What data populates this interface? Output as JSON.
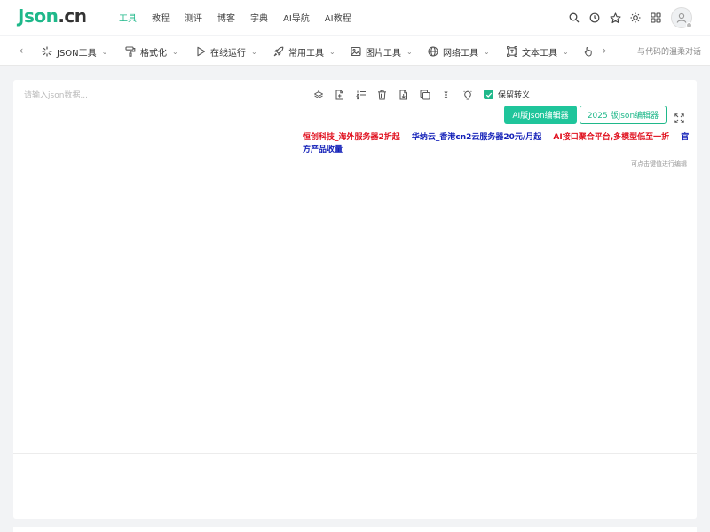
{
  "header": {
    "logo_part1": "Json",
    "logo_part2": ".cn",
    "nav": [
      "工具",
      "教程",
      "测评",
      "博客",
      "字典",
      "AI导航",
      "AI教程"
    ],
    "active_nav": 0,
    "icons": [
      "search-icon",
      "history-icon",
      "star-icon",
      "theme-sun-icon",
      "grid-icon",
      "avatar"
    ]
  },
  "toolbar": {
    "items": [
      {
        "label": "JSON工具",
        "icon": "spinner-icon"
      },
      {
        "label": "格式化",
        "icon": "paint-roller-icon"
      },
      {
        "label": "在线运行",
        "icon": "play-icon"
      },
      {
        "label": "常用工具",
        "icon": "rocket-icon"
      },
      {
        "label": "图片工具",
        "icon": "image-icon"
      },
      {
        "label": "网络工具",
        "icon": "globe-icon"
      },
      {
        "label": "文本工具",
        "icon": "text-frame-icon"
      }
    ],
    "slogan": "与代码的温柔对话"
  },
  "editor": {
    "placeholder": "请输入json数据...",
    "keep_escape_label": "保留转义",
    "keep_escape_checked": true,
    "ai_button": "AI版Json编辑器",
    "button_2025": "2025 版Json编辑器",
    "hint": "可点击键值进行编辑",
    "tools": [
      "layers-icon",
      "file-icon",
      "list-ordered-icon",
      "trash-icon",
      "file-download-icon",
      "copy-icon",
      "compress-icon",
      "lightbulb-icon"
    ]
  },
  "ads": [
    {
      "text": "恒创科技_海外服务器2折起",
      "color": "red"
    },
    {
      "text": "华纳云_香港cn2云服务器20元/月起",
      "color": "blue"
    },
    {
      "text": "AI接口聚合平台,多模型低至一折",
      "color": "red"
    },
    {
      "text": "官方产品收量",
      "color": "blue"
    }
  ],
  "colors": {
    "accent": "#1fb88a",
    "ad_red": "#e0101e",
    "ad_blue": "#1320b8"
  }
}
